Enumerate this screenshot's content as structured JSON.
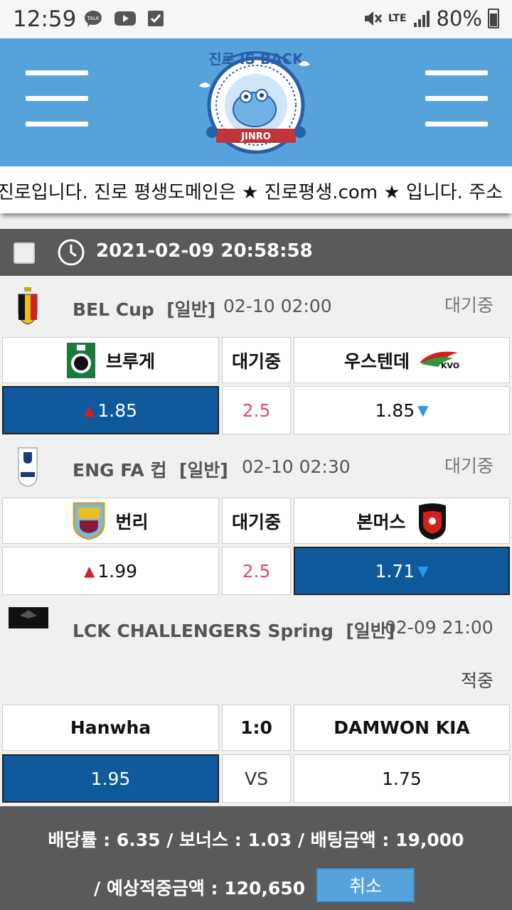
{
  "status_bar": {
    "time": "12:59",
    "notification_icons": [
      "kakaotalk-icon",
      "youtube-icon",
      "checkbox-icon"
    ],
    "network": "LTE",
    "battery": "80%"
  },
  "header": {
    "logo_text_top": "진로 IS BACK",
    "logo_text_bottom": "JINRO",
    "theme_color": "#56a3dc"
  },
  "marquee": {
    "text": "진로입니다. 진로 평생도메인은 ★ 진로평생.com ★ 입니다. 주소"
  },
  "datebar": {
    "datetime": "2021-02-09 20:58:58"
  },
  "matches": [
    {
      "league": "BEL Cup",
      "type": "[일반]",
      "time": "02-10 02:00",
      "status": "대기중",
      "home": "브루게",
      "away": "우스텐데",
      "middle_label": "대기중",
      "home_odds": "1.85",
      "draw_value": "2.5",
      "away_odds": "1.85"
    },
    {
      "league": "ENG FA 컵",
      "type": "[일반]",
      "time": "02-10 02:30",
      "status": "대기중",
      "home": "번리",
      "away": "본머스",
      "middle_label": "대기중",
      "home_odds": "1.99",
      "draw_value": "2.5",
      "away_odds": "1.71"
    },
    {
      "league": "LCK CHALLENGERS Spring",
      "type": "[일반]",
      "time": "02-09 21:00",
      "status": "적중",
      "home": "Hanwha",
      "away": "DAMWON KIA",
      "middle_label": "1:0",
      "home_odds": "1.95",
      "draw_value": "VS",
      "away_odds": "1.75"
    }
  ],
  "footer": {
    "line1": "배당률 : 6.35 / 보너스 : 1.03 / 배팅금액 : 19,000",
    "line2": "/ 예상적중금액 : 120,650",
    "cancel_label": "취소"
  },
  "colors": {
    "selected": "#0e5a9c",
    "dark_bar": "#5a5a5a",
    "up_arrow": "#d32020",
    "down_arrow": "#2a97e8",
    "draw_text": "#d8506a"
  }
}
